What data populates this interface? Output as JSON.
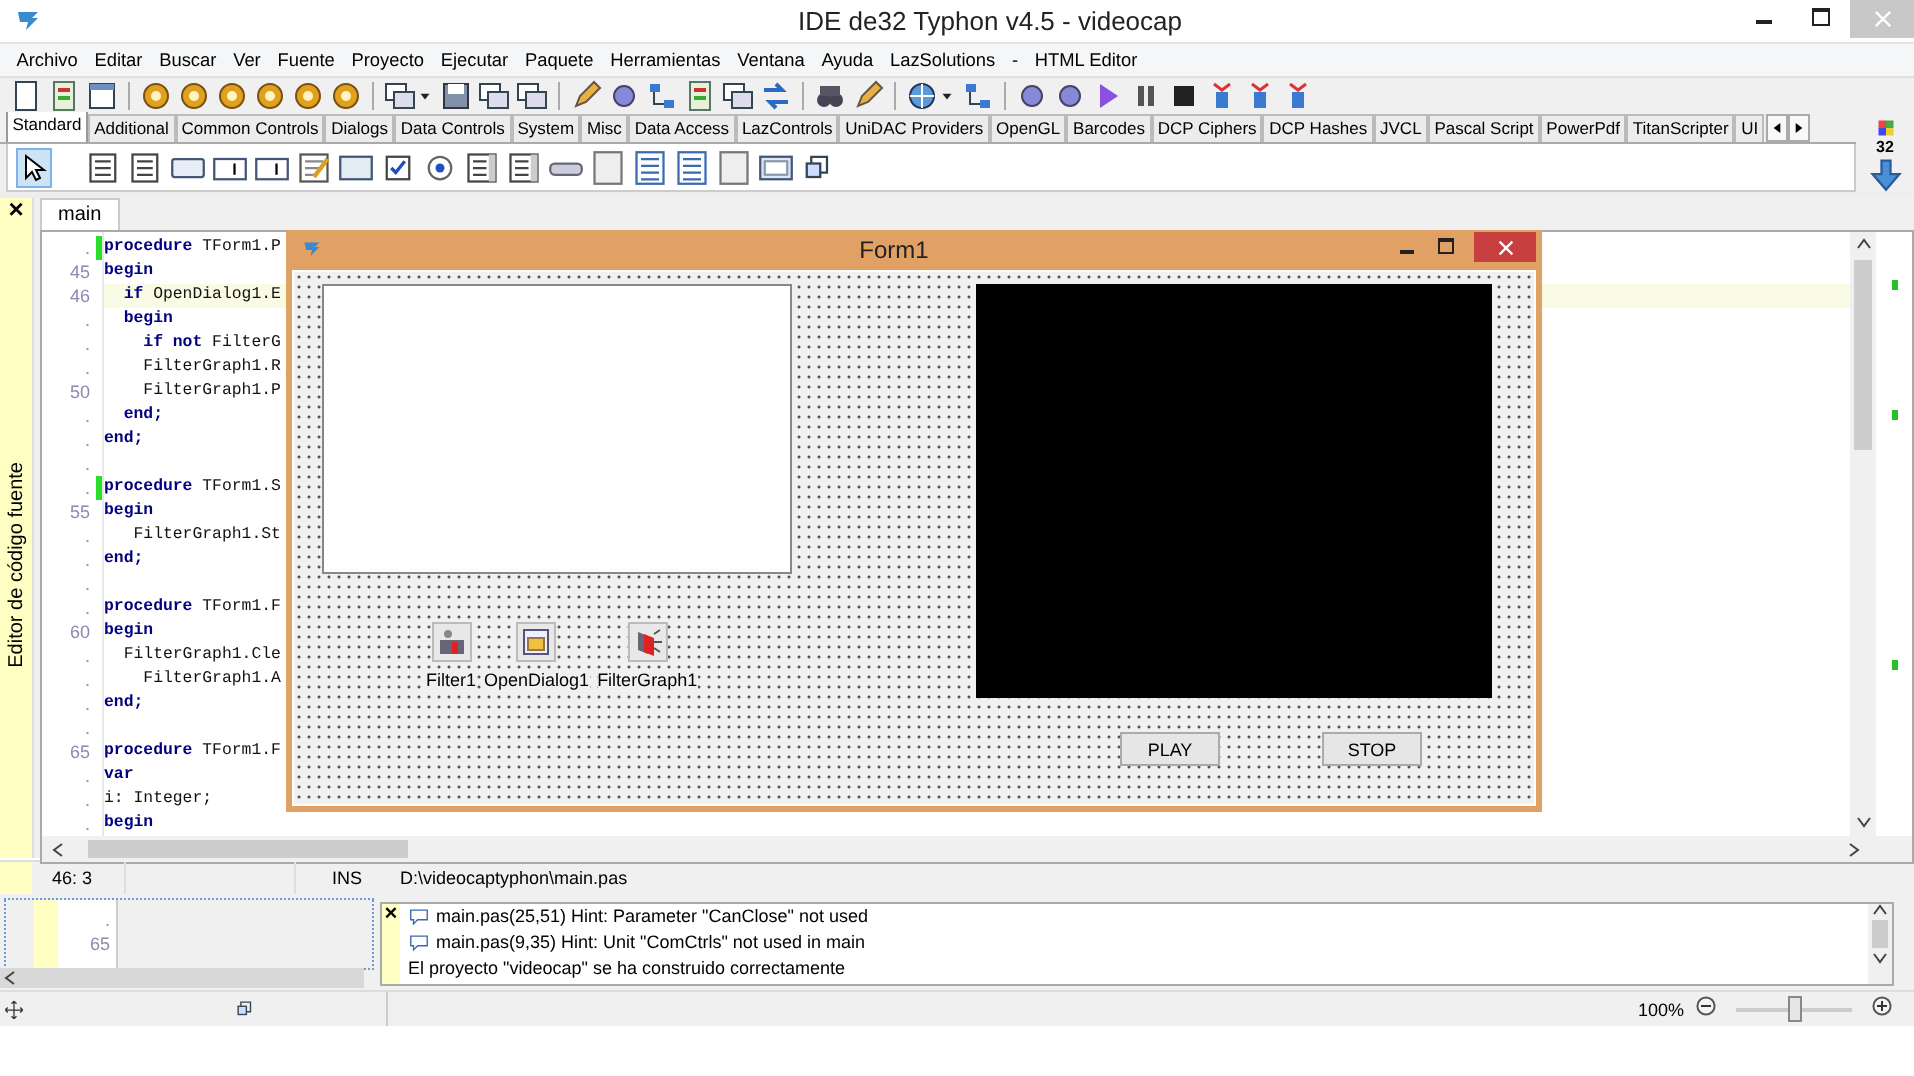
{
  "window": {
    "title": "IDE de32 Typhon v4.5 - videocap"
  },
  "menu": [
    "Archivo",
    "Editar",
    "Buscar",
    "Ver",
    "Fuente",
    "Proyecto",
    "Ejecutar",
    "Paquete",
    "Herramientas",
    "Ventana",
    "Ayuda",
    "LazSolutions",
    "-",
    "HTML Editor"
  ],
  "palette": {
    "tabs": [
      {
        "label": "Standard",
        "selected": true
      },
      {
        "label": "Additional",
        "selected": false
      },
      {
        "label": "Common Controls",
        "selected": false
      },
      {
        "label": "Dialogs",
        "selected": false
      },
      {
        "label": "Data Controls",
        "selected": false
      },
      {
        "label": "System",
        "selected": false
      },
      {
        "label": "Misc",
        "selected": false
      },
      {
        "label": "Data Access",
        "selected": false
      },
      {
        "label": "LazControls",
        "selected": false
      },
      {
        "label": "UniDAC Providers",
        "selected": false
      },
      {
        "label": "OpenGL",
        "selected": false
      },
      {
        "label": "Barcodes",
        "selected": false
      },
      {
        "label": "DCP Ciphers",
        "selected": false
      },
      {
        "label": "DCP Hashes",
        "selected": false
      },
      {
        "label": "JVCL",
        "selected": false
      },
      {
        "label": "Pascal Script",
        "selected": false
      },
      {
        "label": "PowerPdf",
        "selected": false
      },
      {
        "label": "TitanScripter",
        "selected": false
      },
      {
        "label": "UI",
        "selected": false
      }
    ],
    "icon_size": "32"
  },
  "editor": {
    "close_glyph": "×",
    "panel_title": "Editor de código fuente",
    "tabs": [
      {
        "label": "main",
        "selected": true
      }
    ],
    "lines": [
      {
        "number": ".",
        "text": "**procedure** TForm1.P",
        "bold": false,
        "modified": true,
        "current": false
      },
      {
        "number": "45",
        "text": "begin",
        "bold": true,
        "modified": false,
        "current": false
      },
      {
        "number": "46",
        "text": "  **if** OpenDialog1.E",
        "bold": false,
        "modified": false,
        "current": true
      },
      {
        "number": ".",
        "text": "  begin",
        "bold": true,
        "modified": false,
        "current": false
      },
      {
        "number": ".",
        "text": "    **if not** FilterG",
        "bold": false,
        "modified": false,
        "current": false
      },
      {
        "number": ".",
        "text": "    FilterGraph1.R",
        "bold": false,
        "modified": false,
        "current": false
      },
      {
        "number": "50",
        "text": "    FilterGraph1.P",
        "bold": false,
        "modified": false,
        "current": false
      },
      {
        "number": ".",
        "text": "  end;",
        "bold": true,
        "modified": false,
        "current": false
      },
      {
        "number": ".",
        "text": "end;",
        "bold": true,
        "modified": false,
        "current": false
      },
      {
        "number": ".",
        "modified": false,
        "current": false
      },
      {
        "number": ".",
        "text": "**procedure** TForm1.S",
        "bold": false,
        "modified": true,
        "current": false
      },
      {
        "number": "55",
        "text": "begin",
        "bold": true,
        "modified": false,
        "current": false
      },
      {
        "number": ".",
        "text": "   FilterGraph1.St",
        "bold": false,
        "modified": false,
        "current": false
      },
      {
        "number": ".",
        "text": "end;",
        "bold": true,
        "modified": false,
        "current": false
      },
      {
        "number": ".",
        "modified": false,
        "current": false
      },
      {
        "number": ".",
        "text": "**procedure** TForm1.F",
        "bold": false,
        "modified": false,
        "current": false
      },
      {
        "number": "60",
        "text": "begin",
        "bold": true,
        "modified": false,
        "current": false
      },
      {
        "number": ".",
        "text": "  FilterGraph1.Cle",
        "bold": false,
        "modified": false,
        "current": false
      },
      {
        "number": ".",
        "text": "    FilterGraph1.A",
        "bold": false,
        "modified": false,
        "current": false
      },
      {
        "number": ".",
        "text": "end;",
        "bold": true,
        "modified": false,
        "current": false
      },
      {
        "number": ".",
        "modified": false,
        "current": false
      },
      {
        "number": "65",
        "text": "**procedure** TForm1.F",
        "bold": false,
        "modified": false,
        "current": false
      },
      {
        "number": ".",
        "text": "var",
        "bold": true,
        "modified": false,
        "current": false
      },
      {
        "number": ".",
        "text": "i: Integer;",
        "bold": false,
        "modified": false,
        "current": false
      },
      {
        "number": ".",
        "text": "begin",
        "bold": true,
        "modified": false,
        "current": false
      }
    ]
  },
  "form": {
    "title": "Form1",
    "components": [
      {
        "kind": "filter",
        "name": "Filter1"
      },
      {
        "kind": "dialog",
        "name": "OpenDialog1"
      },
      {
        "kind": "graph",
        "name": "FilterGraph1"
      }
    ],
    "buttons": [
      "PLAY",
      "STOP"
    ]
  },
  "status_bar": {
    "position": "46: 3",
    "mode": "INS",
    "file": "D:\\videocaptyphon\\main.pas"
  },
  "mini_editor": {
    "lines": [
      ".",
      "65"
    ]
  },
  "messages_close_glyph": "×",
  "messages": [
    {
      "kind": "hint",
      "text": "main.pas(25,51) Hint: Parameter \"CanClose\" not used"
    },
    {
      "kind": "hint",
      "text": "main.pas(9,35) Hint: Unit \"ComCtrls\" not used in main"
    },
    {
      "kind": "info",
      "text": "El proyecto \"videocap\" se ha construido correctamente"
    }
  ],
  "zoom": {
    "reading": "100%",
    "level": 0.5
  }
}
